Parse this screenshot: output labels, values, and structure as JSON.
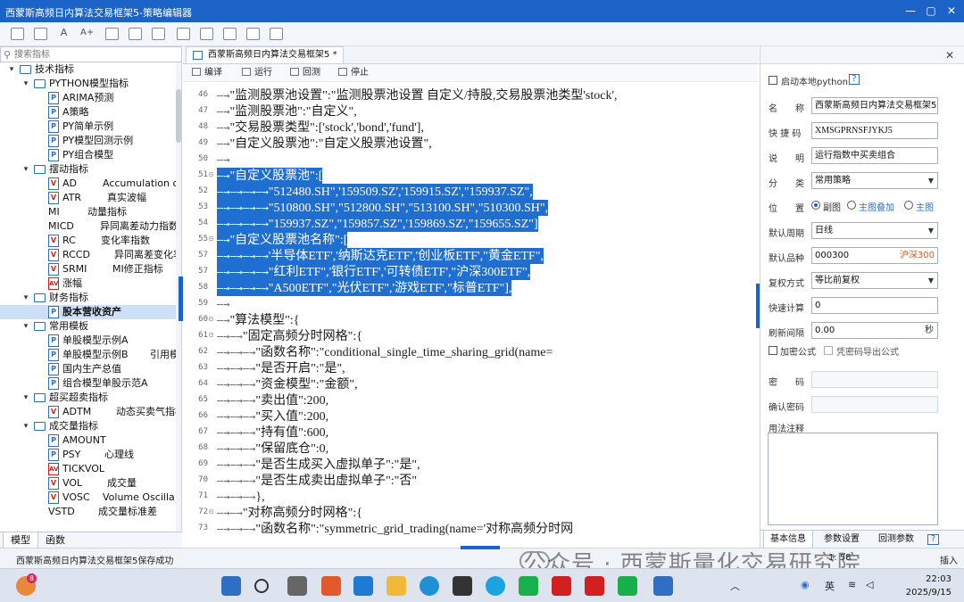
{
  "window": {
    "title": "西蒙斯高频日内算法交易框架5-策略编辑器",
    "controls": [
      "—",
      "▢",
      "✕"
    ]
  },
  "toolbar": {
    "icons": [
      "save-icon",
      "save-as-icon",
      "font-decrease-icon",
      "font-increase-icon",
      "export-icon",
      "import-icon",
      "copy-icon",
      "checklist-icon",
      "paste-icon",
      "cut-icon",
      "doc-icon",
      "lock-icon"
    ],
    "labels": [
      "",
      "",
      "A",
      "A+",
      "",
      "",
      "",
      "",
      "",
      "",
      "",
      ""
    ]
  },
  "left": {
    "search_placeholder": "搜索指标",
    "tree": [
      {
        "level": 0,
        "type": "folder",
        "label": "技术指标",
        "open": true
      },
      {
        "level": 1,
        "type": "folder",
        "label": "PYTHON模型指标",
        "open": true
      },
      {
        "level": 2,
        "type": "file",
        "mark": "P",
        "label": "ARIMA预测"
      },
      {
        "level": 2,
        "type": "file",
        "mark": "P",
        "label": "A策略"
      },
      {
        "level": 2,
        "type": "file",
        "mark": "P",
        "label": "PY简单示例"
      },
      {
        "level": 2,
        "type": "file",
        "mark": "P",
        "label": "PY模型回测示例"
      },
      {
        "level": 2,
        "type": "file",
        "mark": "P",
        "label": "PY组合模型"
      },
      {
        "level": 1,
        "type": "folder",
        "label": "摆动指标",
        "open": true
      },
      {
        "level": 2,
        "type": "file",
        "mark": "V",
        "label": "AD",
        "desc": "Accumulation or"
      },
      {
        "level": 2,
        "type": "file",
        "mark": "V",
        "label": "ATR",
        "desc": "真实波幅"
      },
      {
        "level": 2,
        "type": "none",
        "label": "MI",
        "desc": "动量指标"
      },
      {
        "level": 2,
        "type": "none",
        "label": "MICD",
        "desc": "异同离差动力指数"
      },
      {
        "level": 2,
        "type": "file",
        "mark": "V",
        "label": "RC",
        "desc": "变化率指数"
      },
      {
        "level": 2,
        "type": "file",
        "mark": "V",
        "label": "RCCD",
        "desc": "异同离差变化率"
      },
      {
        "level": 2,
        "type": "file",
        "mark": "V",
        "label": "SRMI",
        "desc": "MI修正指标"
      },
      {
        "level": 2,
        "type": "file",
        "mark": "AV",
        "label": "涨幅"
      },
      {
        "level": 1,
        "type": "folder",
        "label": "财务指标",
        "open": true
      },
      {
        "level": 2,
        "type": "file",
        "mark": "P",
        "label": "股本营收资产",
        "selected": true
      },
      {
        "level": 1,
        "type": "folder",
        "label": "常用模板",
        "open": true
      },
      {
        "level": 2,
        "type": "file",
        "mark": "P",
        "label": "单股模型示例A"
      },
      {
        "level": 2,
        "type": "file",
        "mark": "P",
        "label": "单股模型示例B",
        "desc": "引用模"
      },
      {
        "level": 2,
        "type": "file",
        "mark": "P",
        "label": "国内生产总值"
      },
      {
        "level": 2,
        "type": "file",
        "mark": "P",
        "label": "组合模型单股示范A"
      },
      {
        "level": 1,
        "type": "folder",
        "label": "超买超卖指标",
        "open": true
      },
      {
        "level": 2,
        "type": "file",
        "mark": "V",
        "label": "ADTM",
        "desc": "动态买卖气指标"
      },
      {
        "level": 1,
        "type": "folder",
        "label": "成交量指标",
        "open": true
      },
      {
        "level": 2,
        "type": "file",
        "mark": "P",
        "label": "AMOUNT"
      },
      {
        "level": 2,
        "type": "file",
        "mark": "P",
        "label": "PSY",
        "desc": "心理线"
      },
      {
        "level": 2,
        "type": "file",
        "mark": "AV",
        "label": "TICKVOL"
      },
      {
        "level": 2,
        "type": "file",
        "mark": "V",
        "label": "VOL",
        "desc": "成交量"
      },
      {
        "level": 2,
        "type": "file",
        "mark": "V",
        "label": "VOSC",
        "desc": "Volume Oscilla"
      },
      {
        "level": 2,
        "type": "none",
        "label": "VSTD",
        "desc": "成交量标准差"
      }
    ],
    "tabs": [
      "模型",
      "函数"
    ]
  },
  "editor": {
    "tab_label": "西蒙斯高频日内算法交易框架5",
    "tab_modified": "*",
    "actions": [
      "编译",
      "运行",
      "回测",
      "停止"
    ],
    "lines": [
      {
        "n": 46,
        "fold": "",
        "hl": false,
        "indent": 1,
        "text": "\"监测股票池设置\":\"监测股票池设置 自定义/持股,交易股票池类型'stock',"
      },
      {
        "n": 47,
        "fold": "",
        "hl": false,
        "indent": 1,
        "text": "\"监测股票池\":\"自定义\","
      },
      {
        "n": 48,
        "fold": "",
        "hl": false,
        "indent": 1,
        "text": "\"交易股票类型\":['stock','bond','fund'],"
      },
      {
        "n": 49,
        "fold": "",
        "hl": false,
        "indent": 1,
        "text": "\"自定义股票池\":\"自定义股票池设置\","
      },
      {
        "n": 50,
        "fold": "",
        "hl": false,
        "indent": 0,
        "text": ""
      },
      {
        "n": 51,
        "fold": "⊟",
        "hl": true,
        "indent": 1,
        "text": "\"自定义股票池\":["
      },
      {
        "n": 52,
        "fold": "",
        "hl": true,
        "indent": 4,
        "text": "\"512480.SH\",'159509.SZ','159915.SZ',\"159937.SZ\","
      },
      {
        "n": 53,
        "fold": "",
        "hl": true,
        "indent": 4,
        "text": "\"510800.SH\",\"512800.SH\",\"513100.SH\",\"510300.SH\","
      },
      {
        "n": 54,
        "fold": "",
        "hl": true,
        "indent": 4,
        "text": "\"159937.SZ\",\"159857.SZ\",'159869.SZ',\"159655.SZ\"]"
      },
      {
        "n": 55,
        "fold": "⊟",
        "hl": true,
        "indent": 1,
        "text": "\"自定义股票池名称\":["
      },
      {
        "n": 57,
        "fold": "",
        "hl": true,
        "indent": 4,
        "text": "'半导体ETF','纳斯达克ETF','创业板ETF',\"黄金ETF\","
      },
      {
        "n": 57,
        "fold": "",
        "hl": true,
        "indent": 4,
        "text": "\"红利ETF\",'银行ETF','可转债ETF',\"沪深300ETF\","
      },
      {
        "n": 58,
        "fold": "",
        "hl": true,
        "indent": 4,
        "text": "\"A500ETF\",\"光伏ETF\",'游戏ETF',\"标普ETF\"],"
      },
      {
        "n": 59,
        "fold": "",
        "hl": false,
        "indent": 1,
        "text": ""
      },
      {
        "n": 60,
        "fold": "⊟",
        "hl": false,
        "indent": 1,
        "text": "\"算法模型\":{"
      },
      {
        "n": 61,
        "fold": "⊟",
        "hl": false,
        "indent": 2,
        "text": "\"固定高频分时网格\":{"
      },
      {
        "n": 62,
        "fold": "",
        "hl": false,
        "indent": 3,
        "text": "\"函数名称\":\"conditional_single_time_sharing_grid(name="
      },
      {
        "n": 63,
        "fold": "",
        "hl": false,
        "indent": 3,
        "text": "\"是否开启\":\"是\","
      },
      {
        "n": 64,
        "fold": "",
        "hl": false,
        "indent": 3,
        "text": "\"资金模型\":\"金额\","
      },
      {
        "n": 65,
        "fold": "",
        "hl": false,
        "indent": 3,
        "text": "\"卖出值\":200,"
      },
      {
        "n": 66,
        "fold": "",
        "hl": false,
        "indent": 3,
        "text": "\"买入值\":200,"
      },
      {
        "n": 67,
        "fold": "",
        "hl": false,
        "indent": 3,
        "text": "\"持有值\":600,"
      },
      {
        "n": 68,
        "fold": "",
        "hl": false,
        "indent": 3,
        "text": "\"保留底仓\":0,"
      },
      {
        "n": 69,
        "fold": "",
        "hl": false,
        "indent": 3,
        "text": "\"是否生成买入虚拟单子\":\"是\","
      },
      {
        "n": 70,
        "fold": "",
        "hl": false,
        "indent": 3,
        "text": "\"是否生成卖出虚拟单子\":\"否\""
      },
      {
        "n": 71,
        "fold": "",
        "hl": false,
        "indent": 3,
        "text": "},"
      },
      {
        "n": 72,
        "fold": "⊟",
        "hl": false,
        "indent": 2,
        "text": "\"对称高频分时网格\":{"
      },
      {
        "n": 73,
        "fold": "",
        "hl": false,
        "indent": 3,
        "text": "\"函数名称\":\"symmetric_grid_trading(name='对称高频分时网"
      }
    ]
  },
  "right": {
    "local_python_label": "启动本地python",
    "help": "?",
    "fields": {
      "name_label": "名　　称",
      "name_value": "西蒙斯高频日内算法交易框架5",
      "shortcode_label": "快 捷 码",
      "shortcode_value": "XMSGPRNSFJYKJ5",
      "desc_label": "说　　明",
      "desc_value": "运行指数中买卖组合",
      "category_label": "分　　类",
      "category_value": "常用策略",
      "position_label": "位　　置",
      "position_options": [
        "副图",
        "主图叠加",
        "主图"
      ],
      "period_label": "默认周期",
      "period_value": "日线",
      "symbol_label": "默认品种",
      "symbol_value": "000300",
      "symbol_name": "沪深300",
      "adjust_label": "复权方式",
      "adjust_value": "等比前复权",
      "quickcalc_label": "快速计算",
      "quickcalc_value": "0",
      "refresh_label": "刷新间隔",
      "refresh_value": "0.00",
      "refresh_unit": "秒",
      "encrypt_label": "加密公式",
      "pwd_export_label": "凭密码导出公式",
      "password_label": "密　　码",
      "confirm_label": "确认密码",
      "notes_label": "用法注释"
    },
    "tabs": [
      "基本信息",
      "参数设置",
      "回测参数"
    ]
  },
  "status": {
    "text": "西蒙斯高频日内算法交易框架5保存成功",
    "position": "1: 58",
    "mode": "插入"
  },
  "watermark": "公众号 · 西蒙斯量化交易研究院",
  "taskbar": {
    "badge": "8",
    "tray_lang": "英",
    "time": "22:03",
    "date": "2025/9/15"
  },
  "colors": {
    "accent": "#1b63c6",
    "selection": "#1f6fd1",
    "red": "#d21f1f"
  }
}
